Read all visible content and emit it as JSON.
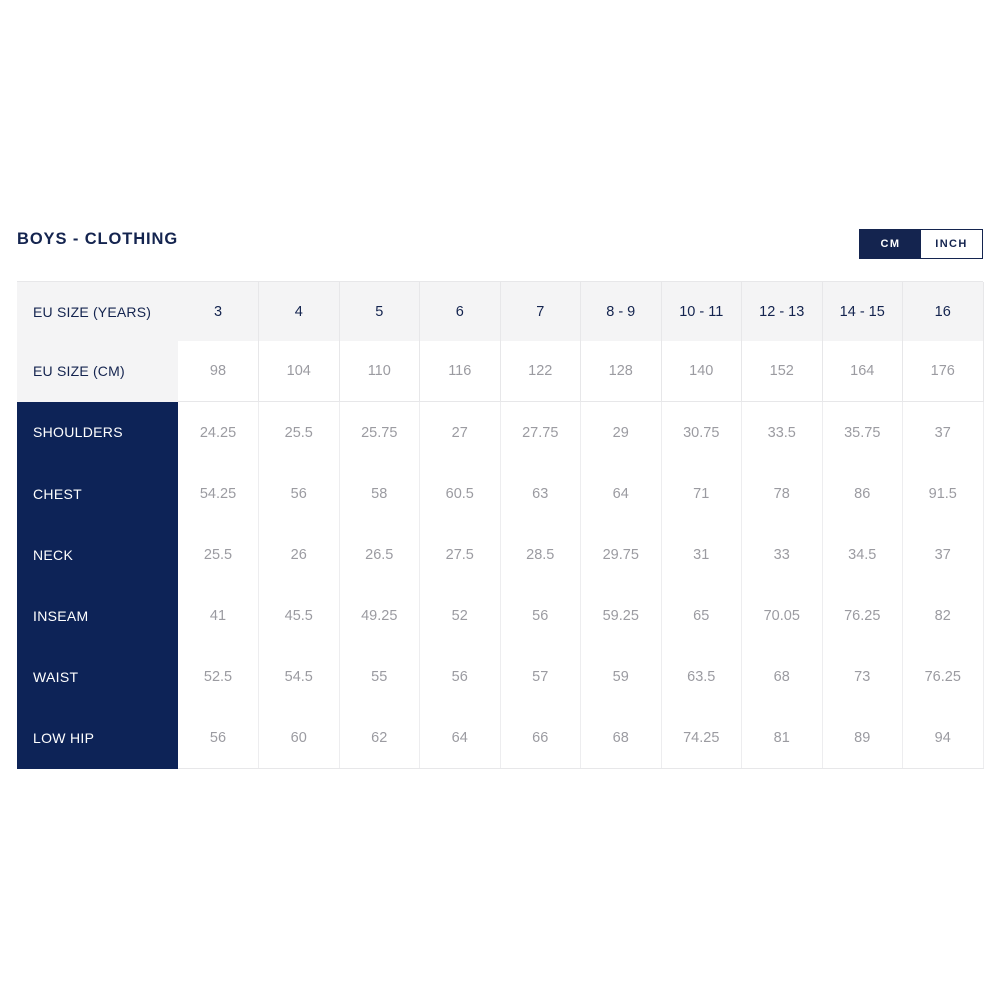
{
  "chart": {
    "title": "BOYS - CLOTHING",
    "unit_toggle": {
      "options": [
        "CM",
        "INCH"
      ],
      "selected": "CM",
      "cm_label": "CM",
      "inch_label": "INCH"
    }
  },
  "chart_data": {
    "type": "table",
    "title": "BOYS - CLOTHING",
    "unit": "CM",
    "row_header_labels": [
      "EU SIZE (YEARS)",
      "EU SIZE (CM)"
    ],
    "categories": [
      "3",
      "4",
      "5",
      "6",
      "7",
      "8 - 9",
      "10 - 11",
      "12 - 13",
      "14 - 15",
      "16"
    ],
    "eu_size_cm": [
      "98",
      "104",
      "110",
      "116",
      "122",
      "128",
      "140",
      "152",
      "164",
      "176"
    ],
    "measurement_labels": [
      "SHOULDERS",
      "CHEST",
      "NECK",
      "INSEAM",
      "WAIST",
      "LOW HIP"
    ],
    "series": [
      {
        "name": "SHOULDERS",
        "values": [
          "24.25",
          "25.5",
          "25.75",
          "27",
          "27.75",
          "29",
          "30.75",
          "33.5",
          "35.75",
          "37"
        ]
      },
      {
        "name": "CHEST",
        "values": [
          "54.25",
          "56",
          "58",
          "60.5",
          "63",
          "64",
          "71",
          "78",
          "86",
          "91.5"
        ]
      },
      {
        "name": "NECK",
        "values": [
          "25.5",
          "26",
          "26.5",
          "27.5",
          "28.5",
          "29.75",
          "31",
          "33",
          "34.5",
          "37"
        ]
      },
      {
        "name": "INSEAM",
        "values": [
          "41",
          "45.5",
          "49.25",
          "52",
          "56",
          "59.25",
          "65",
          "70.05",
          "76.25",
          "82"
        ]
      },
      {
        "name": "WAIST",
        "values": [
          "52.5",
          "54.5",
          "55",
          "56",
          "57",
          "59",
          "63.5",
          "68",
          "73",
          "76.25"
        ]
      },
      {
        "name": "LOW HIP",
        "values": [
          "56",
          "60",
          "62",
          "64",
          "66",
          "68",
          "74.25",
          "81",
          "89",
          "94"
        ]
      }
    ],
    "colors": {
      "navy": "#0d2357",
      "title_navy": "#14244f",
      "header_bg": "#f4f4f5",
      "value_gray": "#9b9ba1",
      "border": "#e7e7e9"
    }
  }
}
